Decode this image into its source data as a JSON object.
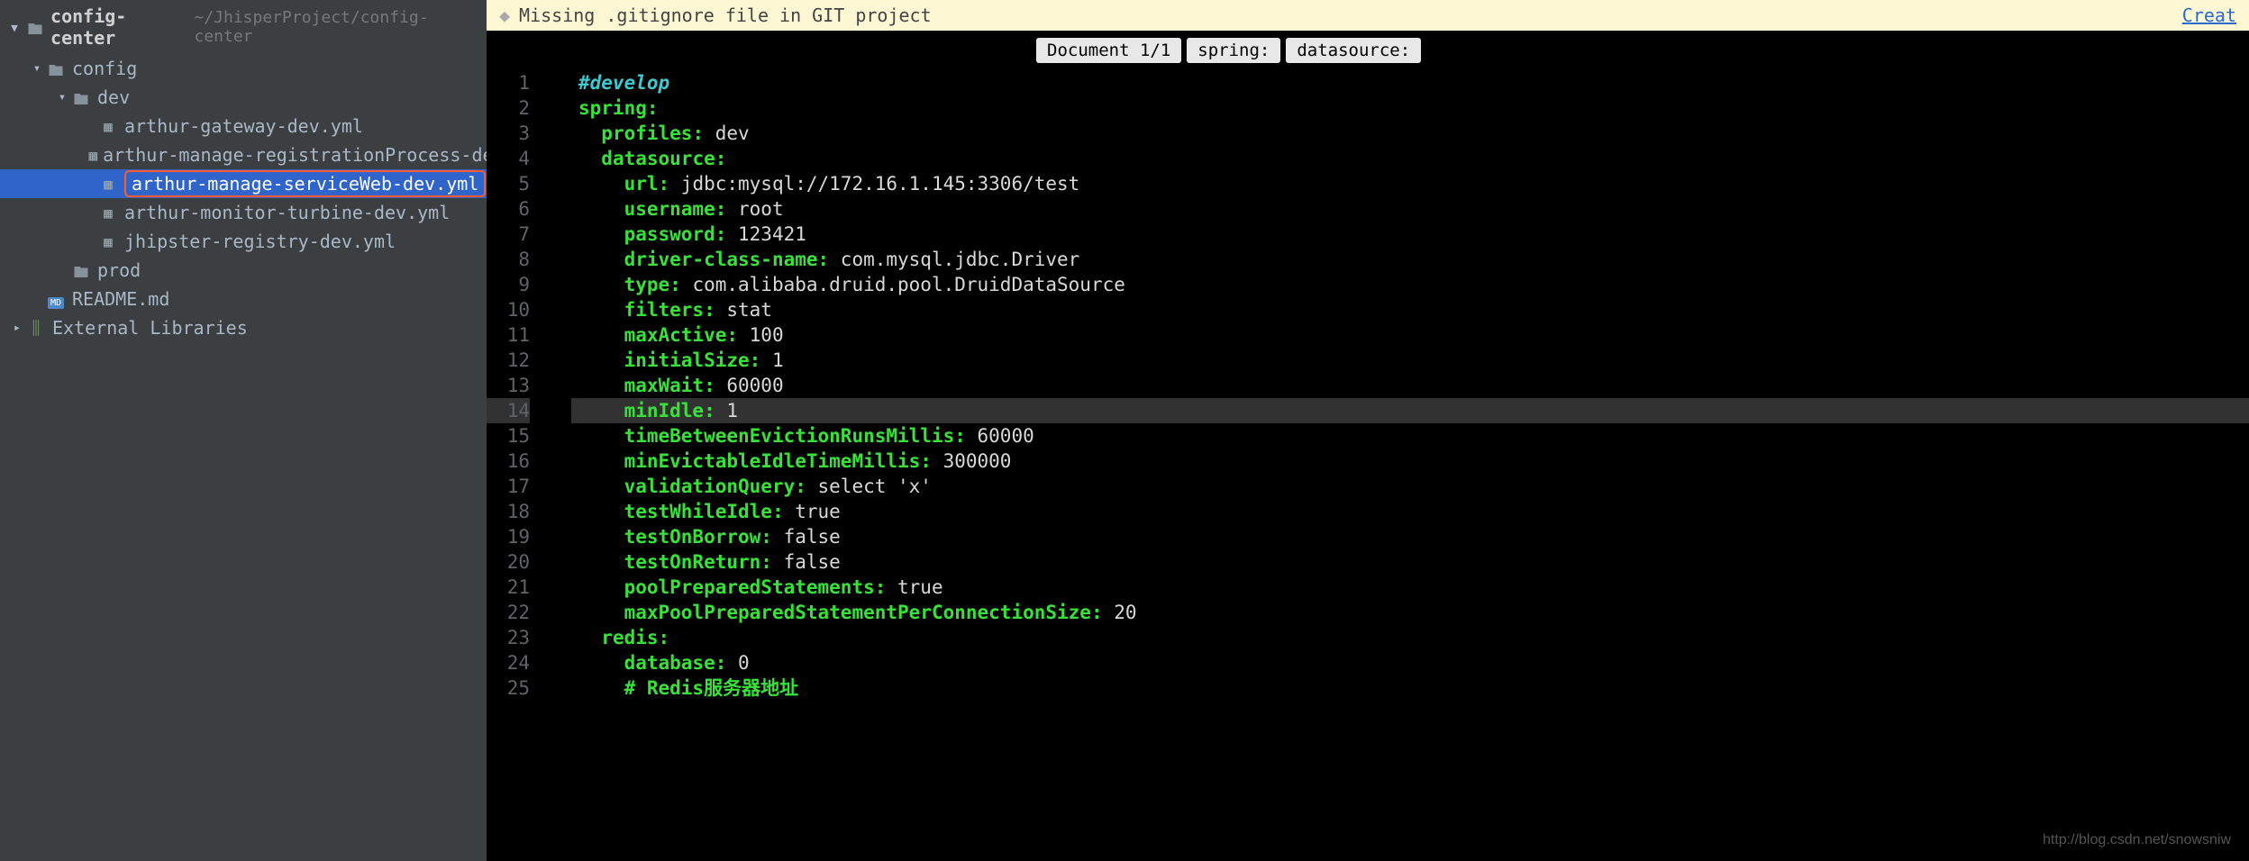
{
  "breadcrumb": {
    "name": "config-center",
    "path": "~/JhisperProject/config-center"
  },
  "tree": {
    "config": "config",
    "dev": "dev",
    "files": [
      "arthur-gateway-dev.yml",
      "arthur-manage-registrationProcess-dev.yml",
      "arthur-manage-serviceWeb-dev.yml",
      "arthur-monitor-turbine-dev.yml",
      "jhipster-registry-dev.yml"
    ],
    "prod": "prod",
    "readme": "README.md",
    "external": "External Libraries"
  },
  "banner": {
    "msg": "Missing .gitignore file in GIT project",
    "link": "Creat"
  },
  "crumbs": [
    "Document 1/1",
    "spring:",
    "datasource:"
  ],
  "code": [
    {
      "n": 1,
      "indent": "",
      "key": "",
      "val": "",
      "comment": "#develop"
    },
    {
      "n": 2,
      "indent": "",
      "key": "spring:",
      "val": ""
    },
    {
      "n": 3,
      "indent": "  ",
      "key": "profiles:",
      "val": " dev"
    },
    {
      "n": 4,
      "indent": "  ",
      "key": "datasource:",
      "val": ""
    },
    {
      "n": 5,
      "indent": "    ",
      "key": "url:",
      "val": " jdbc:mysql://172.16.1.145:3306/test"
    },
    {
      "n": 6,
      "indent": "    ",
      "key": "username:",
      "val": " root"
    },
    {
      "n": 7,
      "indent": "    ",
      "key": "password:",
      "val": " 123421"
    },
    {
      "n": 8,
      "indent": "    ",
      "key": "driver-class-name:",
      "val": " com.mysql.jdbc.Driver"
    },
    {
      "n": 9,
      "indent": "    ",
      "key": "type:",
      "val": " com.alibaba.druid.pool.DruidDataSource"
    },
    {
      "n": 10,
      "indent": "    ",
      "key": "filters:",
      "val": " stat"
    },
    {
      "n": 11,
      "indent": "    ",
      "key": "maxActive:",
      "val": " 100"
    },
    {
      "n": 12,
      "indent": "    ",
      "key": "initialSize:",
      "val": " 1"
    },
    {
      "n": 13,
      "indent": "    ",
      "key": "maxWait:",
      "val": " 60000"
    },
    {
      "n": 14,
      "indent": "    ",
      "key": "minIdle:",
      "val": " 1",
      "current": true
    },
    {
      "n": 15,
      "indent": "    ",
      "key": "timeBetweenEvictionRunsMillis:",
      "val": " 60000"
    },
    {
      "n": 16,
      "indent": "    ",
      "key": "minEvictableIdleTimeMillis:",
      "val": " 300000"
    },
    {
      "n": 17,
      "indent": "    ",
      "key": "validationQuery:",
      "val": " select 'x'"
    },
    {
      "n": 18,
      "indent": "    ",
      "key": "testWhileIdle:",
      "val": " true"
    },
    {
      "n": 19,
      "indent": "    ",
      "key": "testOnBorrow:",
      "val": " false"
    },
    {
      "n": 20,
      "indent": "    ",
      "key": "testOnReturn:",
      "val": " false"
    },
    {
      "n": 21,
      "indent": "    ",
      "key": "poolPreparedStatements:",
      "val": " true"
    },
    {
      "n": 22,
      "indent": "    ",
      "key": "maxPoolPreparedStatementPerConnectionSize:",
      "val": " 20"
    },
    {
      "n": 23,
      "indent": "  ",
      "key": "redis:",
      "val": ""
    },
    {
      "n": 24,
      "indent": "    ",
      "key": "database:",
      "val": " 0"
    },
    {
      "n": 25,
      "indent": "    ",
      "key": "",
      "val": "",
      "comment2": "# Redis服务器地址"
    }
  ],
  "watermark": "http://blog.csdn.net/snowsniw"
}
